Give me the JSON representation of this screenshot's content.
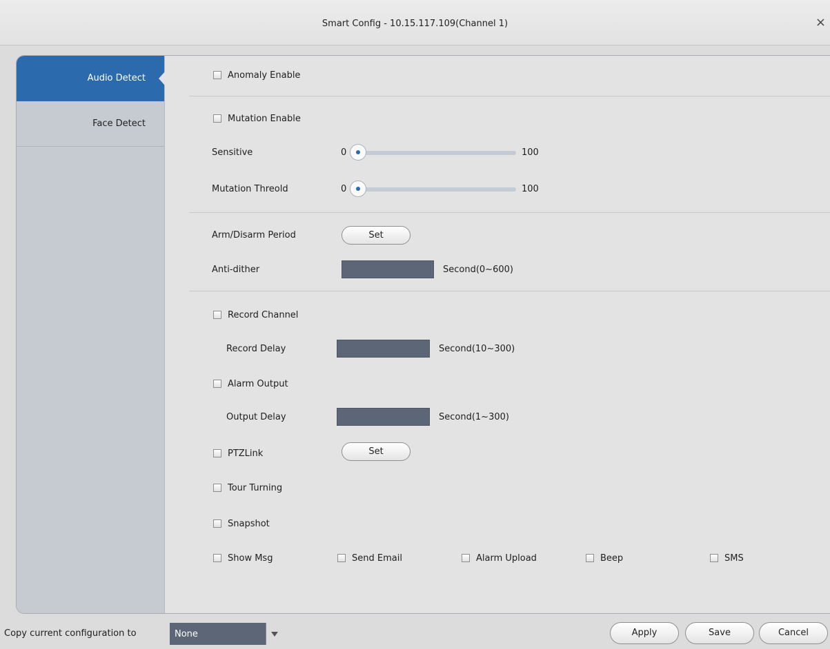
{
  "window": {
    "title": "Smart Config - 10.15.117.109(Channel 1)",
    "close_glyph": "×"
  },
  "sidebar": {
    "items": [
      {
        "label": "Audio Detect",
        "active": true
      },
      {
        "label": "Face Detect",
        "active": false
      }
    ]
  },
  "audio": {
    "anomaly_enable": "Anomaly Enable",
    "mutation_enable": "Mutation Enable",
    "sensitive": {
      "label": "Sensitive",
      "min": "0",
      "max": "100",
      "value": 0
    },
    "mutation_threshold": {
      "label": "Mutation Threold",
      "min": "0",
      "max": "100",
      "value": 0
    },
    "arm_disarm": {
      "label": "Arm/Disarm Period",
      "button": "Set"
    },
    "anti_dither": {
      "label": "Anti-dither",
      "value": "",
      "unit": "Second(0~600)"
    },
    "record_channel": "Record Channel",
    "record_delay": {
      "label": "Record Delay",
      "value": "",
      "unit": "Second(10~300)"
    },
    "alarm_output": "Alarm Output",
    "output_delay": {
      "label": "Output Delay",
      "value": "",
      "unit": "Second(1~300)"
    },
    "ptz_link": {
      "label": "PTZLink",
      "button": "Set"
    },
    "tour_turning": "Tour Turning",
    "snapshot": "Snapshot",
    "show_msg": "Show Msg",
    "send_email": "Send Email",
    "alarm_upload": "Alarm Upload",
    "beep": "Beep",
    "sms": "SMS"
  },
  "footer": {
    "copy_label": "Copy current configuration to",
    "copy_value": "None",
    "apply": "Apply",
    "save": "Save",
    "cancel": "Cancel"
  },
  "colors": {
    "accent": "#2b6aad",
    "input_fill": "#5d6676",
    "sidebar": "#c6cad1"
  }
}
